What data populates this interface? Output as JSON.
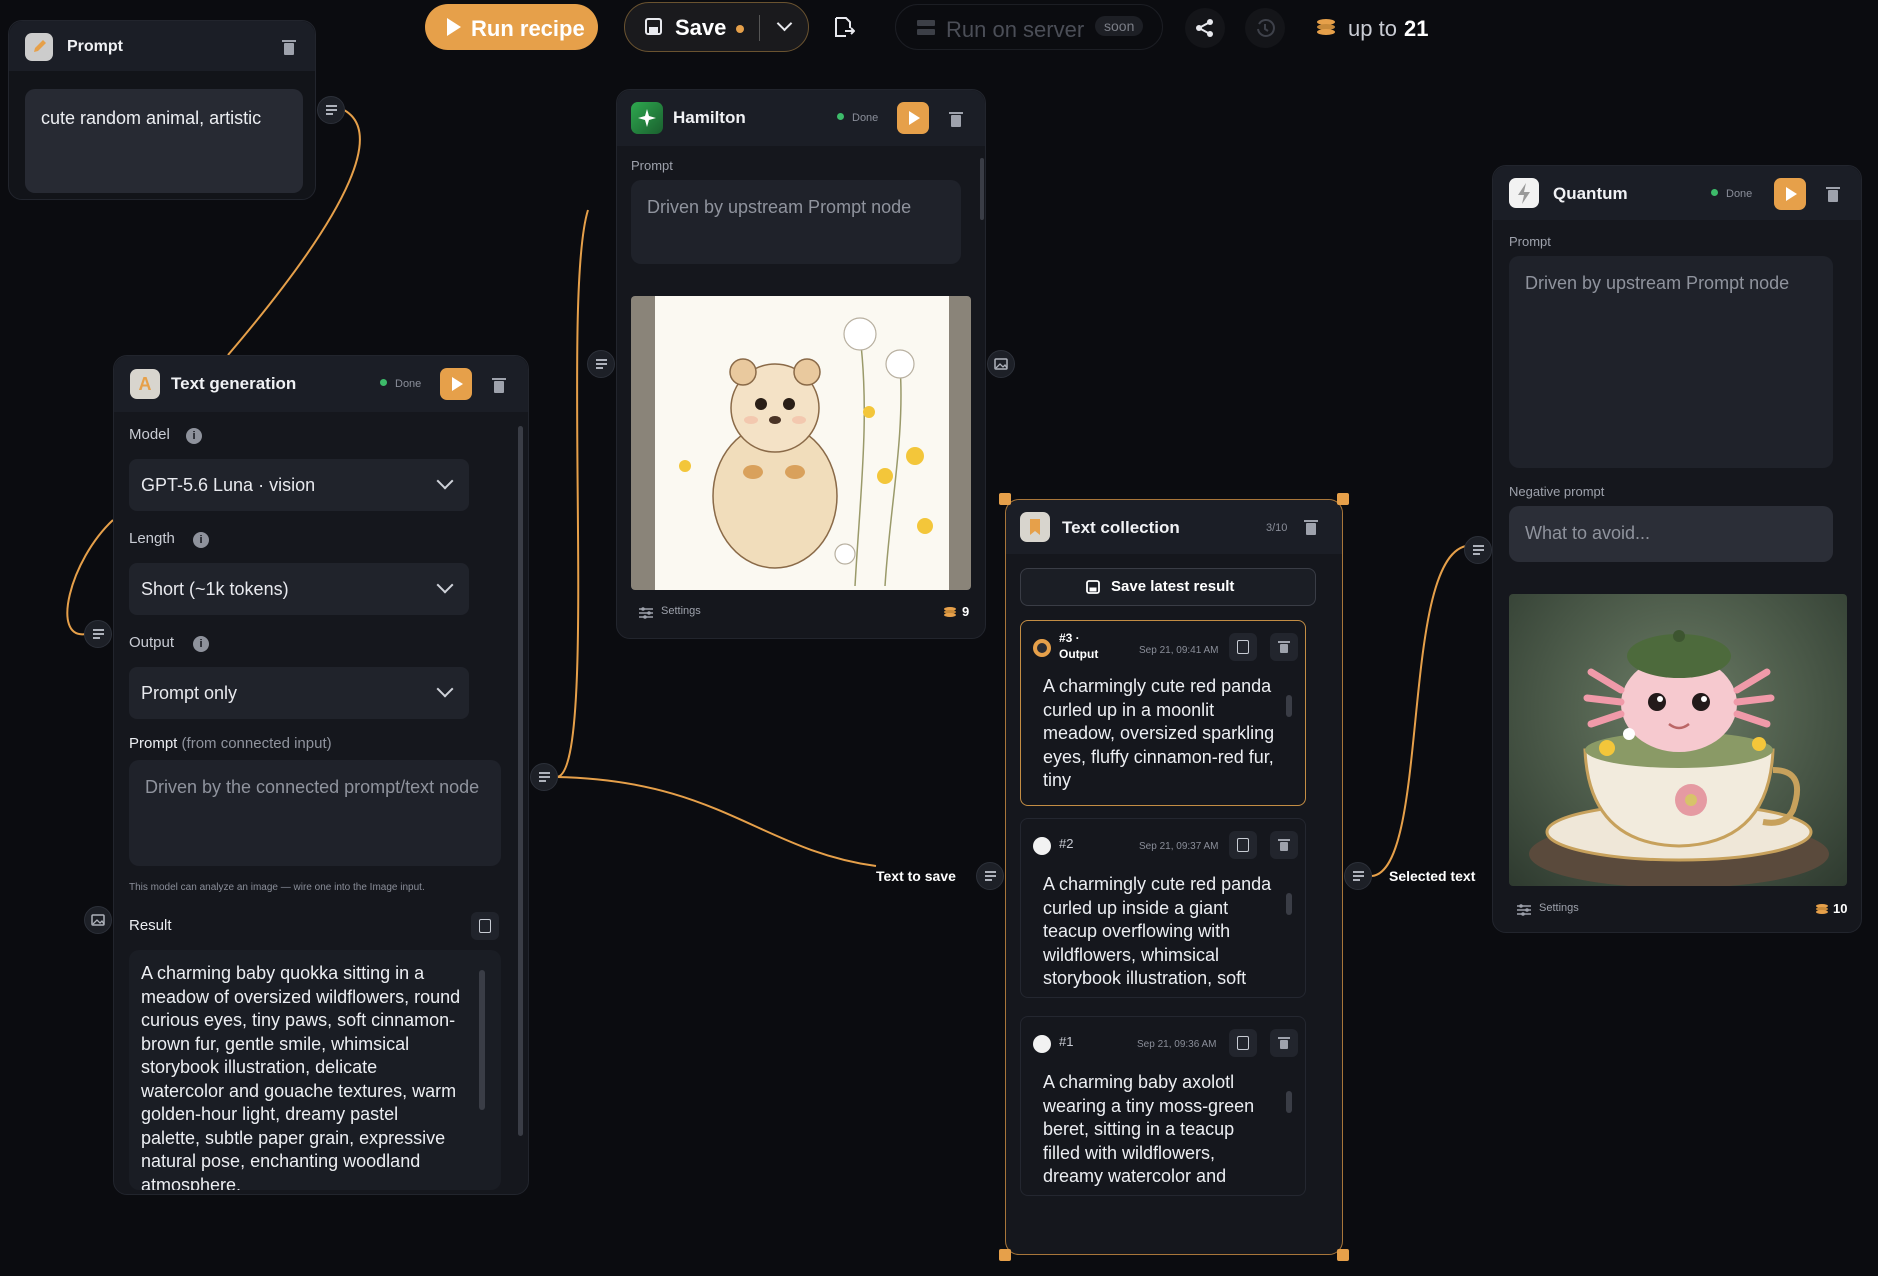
{
  "toolbar": {
    "run_label": "Run recipe",
    "save_label": "Save",
    "run_server_label": "Run on server",
    "soon_label": "soon",
    "credits_prefix": "up to",
    "credits_value": "21"
  },
  "prompt_node": {
    "title": "Prompt",
    "text": "cute random animal, artistic"
  },
  "text_gen_node": {
    "title": "Text generation",
    "badge_letter": "A",
    "status": "Done",
    "model_label": "Model",
    "model_value": "GPT-5.6 Luna · vision",
    "length_label": "Length",
    "length_value": "Short (~1k tokens)",
    "output_label": "Output",
    "output_value": "Prompt only",
    "prompt_label": "Prompt",
    "prompt_hint": "(from connected input)",
    "prompt_placeholder": "Driven by the connected prompt/text node",
    "vision_note": "This model can analyze an image — wire one into the Image input.",
    "result_label": "Result",
    "result_text": "A charming baby quokka sitting in a meadow of oversized wildflowers, round curious eyes, tiny paws, soft cinnamon-brown fur, gentle smile, whimsical storybook illustration, delicate watercolor and gouache textures, warm golden-hour light, dreamy pastel palette, subtle paper grain, expressive natural pose, enchanting woodland atmosphere,"
  },
  "hamilton_node": {
    "title": "Hamilton",
    "status": "Done",
    "prompt_label": "Prompt",
    "prompt_placeholder": "Driven by upstream Prompt node",
    "settings_label": "Settings",
    "credits": "9"
  },
  "collection_node": {
    "title": "Text collection",
    "count": "3/10",
    "save_button_label": "Save latest result",
    "input_port_label": "Text to save",
    "output_port_label": "Selected text",
    "items": [
      {
        "id": "#3 ·",
        "tag": "Output",
        "time": "Sep 21, 09:41 AM",
        "text": "A charmingly cute red panda curled up in a moonlit meadow, oversized sparkling eyes, fluffy cinnamon-red fur, tiny"
      },
      {
        "id": "#2",
        "tag": "",
        "time": "Sep 21, 09:37 AM",
        "text": "A charmingly cute red panda curled up inside a giant teacup overflowing with wildflowers, whimsical storybook illustration, soft"
      },
      {
        "id": "#1",
        "tag": "",
        "time": "Sep 21, 09:36 AM",
        "text": "A charming baby axolotl wearing a tiny moss-green beret, sitting in a teacup filled with wildflowers, dreamy watercolor and"
      }
    ]
  },
  "quantum_node": {
    "title": "Quantum",
    "status": "Done",
    "prompt_label": "Prompt",
    "prompt_placeholder": "Driven by upstream Prompt node",
    "negative_label": "Negative prompt",
    "negative_placeholder": "What to avoid...",
    "settings_label": "Settings",
    "credits": "10"
  },
  "icons": {
    "run": "play-icon",
    "save": "floppy-icon",
    "export": "export-icon",
    "server": "server-icon",
    "share": "share-icon",
    "history": "history-icon",
    "coins": "coins-icon",
    "delete": "trash-icon",
    "copy": "copy-icon",
    "text_port": "text-lines-icon",
    "image_port": "image-icon",
    "settings": "sliders-icon"
  },
  "colors": {
    "accent": "#e6a04a",
    "canvas": "#0b0c10",
    "node": "#15171d",
    "done": "#3dbb6a"
  }
}
